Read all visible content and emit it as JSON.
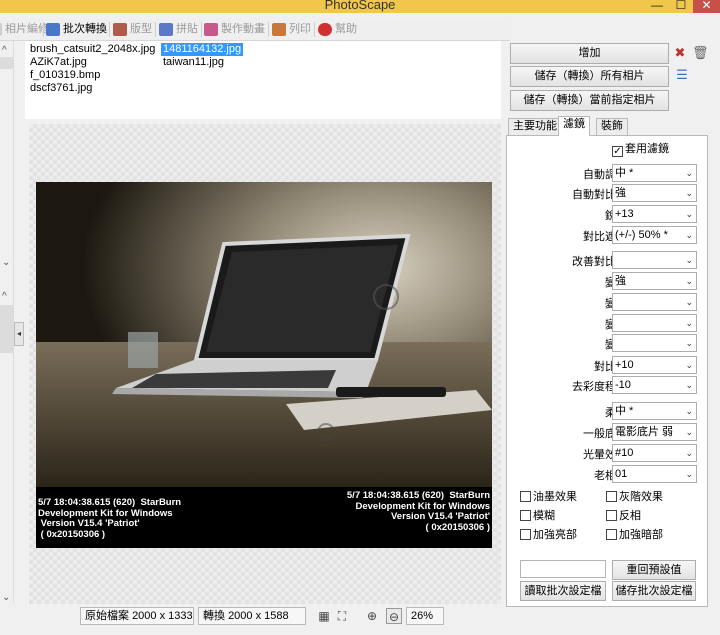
{
  "window": {
    "title": "PhotoScape",
    "min": "—",
    "max": "☐",
    "close": "✕"
  },
  "toolbar": {
    "tabs": [
      {
        "label": "相片編修",
        "icon": "photo-edit-icon",
        "color": "#999999"
      },
      {
        "label": "批次轉換",
        "icon": "batch-convert-icon",
        "color": "#4a78c8"
      },
      {
        "label": "版型",
        "icon": "template-icon",
        "color": "#b05a4a"
      },
      {
        "label": "拼貼",
        "icon": "collage-icon",
        "color": "#5a7ac8"
      },
      {
        "label": "製作動畫",
        "icon": "animation-icon",
        "color": "#c85a8a"
      },
      {
        "label": "列印",
        "icon": "print-icon",
        "color": "#c8783a"
      },
      {
        "label": "幫助",
        "icon": "help-icon",
        "color": "#d03030"
      }
    ]
  },
  "files": [
    {
      "name": "brush_catsuit2_2048x.jpg",
      "selected": false
    },
    {
      "name": "1481164132.jpg",
      "selected": true
    },
    {
      "name": "AZiK7at.jpg",
      "selected": false
    },
    {
      "name": "taiwan11.jpg",
      "selected": false
    },
    {
      "name": "f_010319.bmp",
      "selected": false
    },
    {
      "name": "dscf3761.jpg",
      "selected": false
    }
  ],
  "photo": {
    "caption_left": "5/7 18:04:38.615 (620)  StarBurn\nDevelopment Kit for Windows\n Version V15.4 'Patriot'\n ( 0x20150306 )",
    "caption_right": "5/7 18:04:38.615 (620)  StarBurn\nDevelopment Kit for Windows\nVersion V15.4 'Patriot'\n( 0x20150306 )"
  },
  "statusbar": {
    "original_label": "原始檔案",
    "original_size": "2000 x 1333",
    "convert_label": "轉換",
    "convert_size": "2000 x 1588",
    "zoom": "26%"
  },
  "panel": {
    "add_button": "增加",
    "save_all_button": "儲存（轉換）所有相片",
    "save_current_button": "儲存（轉換）當前指定相片",
    "tabs": [
      "主要功能",
      "濾鏡",
      "裝飾"
    ],
    "active_tab": 1,
    "apply_filter_label": "套用濾鏡",
    "apply_filter_checked": true,
    "settings": [
      {
        "label": "自動調整",
        "value": "中 *"
      },
      {
        "label": "自動對比度",
        "value": "強"
      },
      {
        "label": "銳化",
        "value": "+13"
      },
      {
        "label": "對比遮罩",
        "value": "(+/-) 50% *"
      },
      {
        "label": "改善對比度",
        "value": ""
      },
      {
        "label": "變深",
        "value": "強"
      },
      {
        "label": "變亮",
        "value": ""
      },
      {
        "label": "變暗",
        "value": ""
      },
      {
        "label": "變亮",
        "value": ""
      },
      {
        "label": "對比度",
        "value": "+10"
      },
      {
        "label": "去彩度程度",
        "value": "-10"
      },
      {
        "label": "柔焦",
        "value": "中 *"
      },
      {
        "label": "一般底片",
        "value": "電影底片 弱"
      },
      {
        "label": "光暈效果",
        "value": "#10"
      },
      {
        "label": "老相片",
        "value": "01"
      }
    ],
    "checkboxes": [
      {
        "label": "油墨效果",
        "checked": false
      },
      {
        "label": "灰階效果",
        "checked": false
      },
      {
        "label": "模糊",
        "checked": false
      },
      {
        "label": "反相",
        "checked": false
      },
      {
        "label": "加強亮部",
        "checked": false
      },
      {
        "label": "加強暗部",
        "checked": false
      }
    ],
    "reset_button": "重回預設值",
    "load_button": "讀取批次設定檔",
    "save_settings_button": "儲存批次設定檔"
  }
}
